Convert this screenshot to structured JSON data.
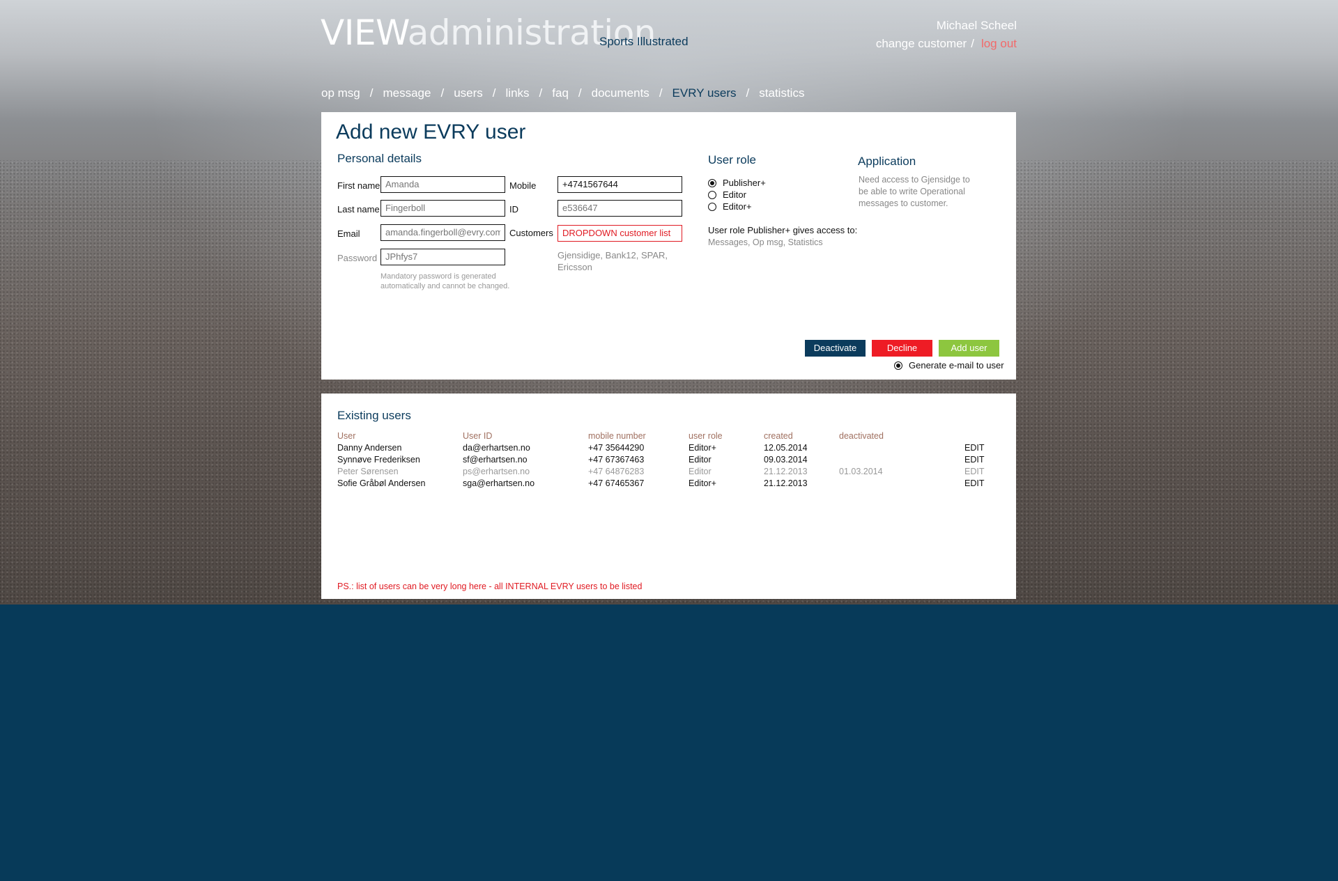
{
  "header": {
    "logo_bold": "VIEW",
    "logo_light": "administration",
    "client": "Sports Illustrated",
    "user_name": "Michael Scheel",
    "change_customer": "change customer",
    "separator": "/",
    "log_out": "log out"
  },
  "nav": {
    "items": [
      "op msg",
      "message",
      "users",
      "links",
      "faq",
      "documents",
      "EVRY users",
      "statistics"
    ],
    "separator": "/",
    "active": "EVRY users"
  },
  "form": {
    "title": "Add new EVRY user",
    "personal_details": "Personal details",
    "first_name_label": "First name",
    "first_name_placeholder": "Amanda",
    "last_name_label": "Last name",
    "last_name_placeholder": "Fingerboll",
    "email_label": "Email",
    "email_placeholder": "amanda.fingerboll@evry.com",
    "password_label": "Password",
    "password_placeholder": "JPhfys7",
    "password_note_1": "Mandatory password is generated",
    "password_note_2": "automatically and cannot be changed.",
    "mobile_label": "Mobile",
    "mobile_value": "+4741567644",
    "id_label": "ID",
    "id_placeholder": "e536647",
    "customers_label": "Customers",
    "customers_value": "DROPDOWN customer list",
    "customers_note_1": "Gjensidige, Bank12, SPAR,",
    "customers_note_2": "Ericsson",
    "user_role_title": "User role",
    "roles": [
      "Publisher+",
      "Editor",
      "Editor+"
    ],
    "selected_role": "Publisher+",
    "role_access_label": "User role Publisher+ gives access to:",
    "role_access_value": "Messages, Op msg, Statistics",
    "application_title": "Application",
    "application_line_1": "Need access to Gjensidge to",
    "application_line_2": "be able to write Operational",
    "application_line_3": "messages to customer.",
    "deactivate": "Deactivate",
    "decline": "Decline",
    "add_user": "Add user",
    "generate_email": "Generate e-mail to user"
  },
  "existing": {
    "title": "Existing users",
    "columns": [
      "User",
      "User ID",
      "mobile number",
      "user role",
      "created",
      "deactivated",
      ""
    ],
    "rows": [
      {
        "user": "Danny Andersen",
        "id": "da@erhartsen.no",
        "mobile": "+47 35644290",
        "role": "Editor+",
        "created": "12.05.2014",
        "deactivated": "",
        "action": "EDIT",
        "active": true
      },
      {
        "user": "Synnøve Frederiksen",
        "id": "sf@erhartsen.no",
        "mobile": "+47 67367463",
        "role": "Editor",
        "created": "09.03.2014",
        "deactivated": "",
        "action": "EDIT",
        "active": true
      },
      {
        "user": "Peter Sørensen",
        "id": "ps@erhartsen.no",
        "mobile": "+47 64876283",
        "role": "Editor",
        "created": "21.12.2013",
        "deactivated": "01.03.2014",
        "action": "EDIT",
        "active": false
      },
      {
        "user": "Sofie Gråbøl Andersen",
        "id": "sga@erhartsen.no",
        "mobile": "+47 67465367",
        "role": "Editor+",
        "created": "21.12.2013",
        "deactivated": "",
        "action": "EDIT",
        "active": true
      }
    ],
    "ps_note": "PS.: list of users can be very long here - all INTERNAL EVRY users to be listed"
  },
  "colors": {
    "navy": "#0b3b5c",
    "red": "#ee1c25",
    "green": "#8dc63f",
    "logout": "#f26a6a",
    "page_bottom": "#073a59"
  }
}
